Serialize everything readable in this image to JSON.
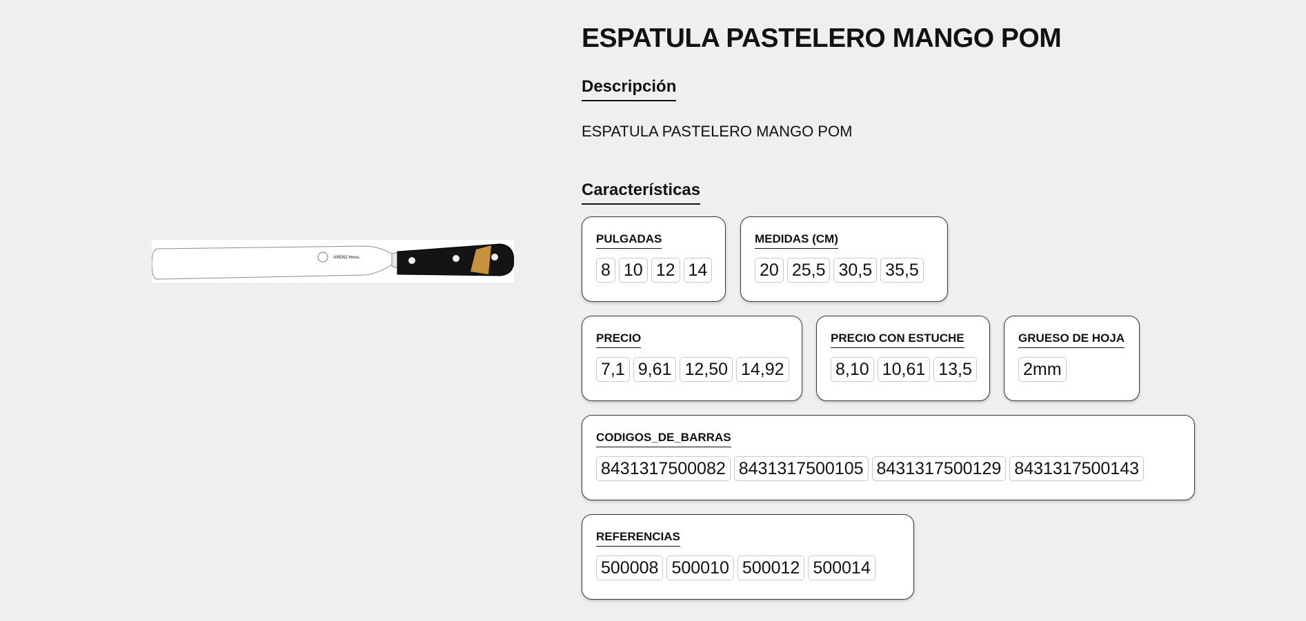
{
  "product": {
    "title": "ESPATULA PASTELERO MANGO POM",
    "image_label": "ARENZ Hnos."
  },
  "description": {
    "heading": "Descripción",
    "text": "ESPATULA PASTELERO MANGO POM"
  },
  "characteristics": {
    "heading": "Características",
    "pulgadas": {
      "label": "PULGADAS",
      "values": [
        "8",
        "10",
        "12",
        "14"
      ]
    },
    "medidas": {
      "label": "MEDIDAS (CM)",
      "values": [
        "20",
        "25,5",
        "30,5",
        "35,5"
      ]
    },
    "precio": {
      "label": "PRECIO",
      "values": [
        "7,1",
        "9,61",
        "12,50",
        "14,92"
      ]
    },
    "precio_estuche": {
      "label": "PRECIO CON ESTUCHE",
      "values": [
        "8,10",
        "10,61",
        "13,5"
      ]
    },
    "grueso": {
      "label": "GRUESO DE HOJA",
      "values": [
        "2mm"
      ]
    },
    "codigos": {
      "label": "CODIGOS_DE_BARRAS",
      "values": [
        "8431317500082",
        "8431317500105",
        "8431317500129",
        "8431317500143"
      ]
    },
    "referencias": {
      "label": "REFERENCIAS",
      "values": [
        "500008",
        "500010",
        "500012",
        "500014"
      ]
    }
  }
}
